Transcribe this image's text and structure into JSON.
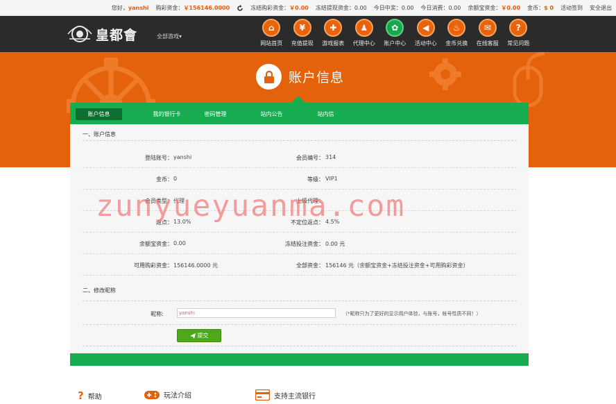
{
  "topbar": {
    "greeting": "您好，",
    "username": "yanshi",
    "lottery_label": "购彩资金：",
    "lottery_value": "￥156146.0000",
    "frozen_lottery_label": "冻结购彩资金：",
    "frozen_lottery_value": "￥0.00",
    "frozen_withdraw": "冻结提现资金：0.00",
    "today_win": "今日中奖：0.00",
    "today_spend": "今日消费：0.00",
    "yuebao_label": "余额宝资金：",
    "yuebao_value": "￥0.00",
    "coins_label": "金币：",
    "coins_value": "$ 0",
    "signin": "活动签到",
    "logout": "安全退出"
  },
  "header": {
    "logo_text": "皇都會",
    "all_games": "全部游戏"
  },
  "nav": [
    {
      "label": "网站首页",
      "icon": "home-icon",
      "glyph": "⌂"
    },
    {
      "label": "充值提现",
      "icon": "yen-icon",
      "glyph": "¥"
    },
    {
      "label": "游戏报表",
      "icon": "gamepad-icon",
      "glyph": "✚"
    },
    {
      "label": "代理中心",
      "icon": "users-icon",
      "glyph": "♟"
    },
    {
      "label": "账户中心",
      "icon": "gear-icon",
      "glyph": "✿"
    },
    {
      "label": "活动中心",
      "icon": "megaphone-icon",
      "glyph": "◀"
    },
    {
      "label": "金币兑换",
      "icon": "flame-icon",
      "glyph": "♨"
    },
    {
      "label": "在线客服",
      "icon": "chat-icon",
      "glyph": "✉"
    },
    {
      "label": "常见问题",
      "icon": "question-icon",
      "glyph": "?"
    }
  ],
  "page": {
    "title": "账户信息"
  },
  "tabs": [
    {
      "label": "账户信息",
      "active": true
    },
    {
      "label": "我的银行卡",
      "active": false
    },
    {
      "label": "密码管理",
      "active": false
    },
    {
      "label": "站内公告",
      "active": false
    },
    {
      "label": "站内信",
      "active": false
    }
  ],
  "account": {
    "section_title": "一、账户信息",
    "rows": [
      {
        "l_label": "登陆账号：",
        "l_value": "yanshi",
        "r_label": "会员编号：",
        "r_value": "314"
      },
      {
        "l_label": "金币：",
        "l_value": "0",
        "r_label": "等级：",
        "r_value": "VIP1"
      },
      {
        "l_label": "会员类型：",
        "l_value": "代理",
        "r_label": "上级代理：",
        "r_value": ""
      },
      {
        "l_label": "返点：",
        "l_value": "13.0%",
        "r_label": "不定位返点：",
        "r_value": "4.5%"
      },
      {
        "l_label": "余额宝资金：",
        "l_value": "0.00",
        "r_label": "冻结投注资金：",
        "r_value": "0.00 元"
      },
      {
        "l_label": "可用购彩资金：",
        "l_value": "156146.0000 元",
        "r_label": "全部资金：",
        "r_value": "156146 元（余额宝资金+冻结投注资金+可用购彩资金）"
      }
    ]
  },
  "nickname": {
    "section_title": "二、修改昵称",
    "label": "昵称:",
    "value": "yanshi",
    "hint": "（*昵称只为了更好的显示用户体验，与账号，帐号性质不同！）",
    "submit": "提交"
  },
  "watermark": "zunyueyuanma.com",
  "footer": {
    "help": "帮助",
    "howto": "玩法介绍",
    "banks": "支持主流银行"
  },
  "colors": {
    "orange": "#e4620b",
    "green": "#16ad51",
    "dark": "#2b2b2b"
  }
}
